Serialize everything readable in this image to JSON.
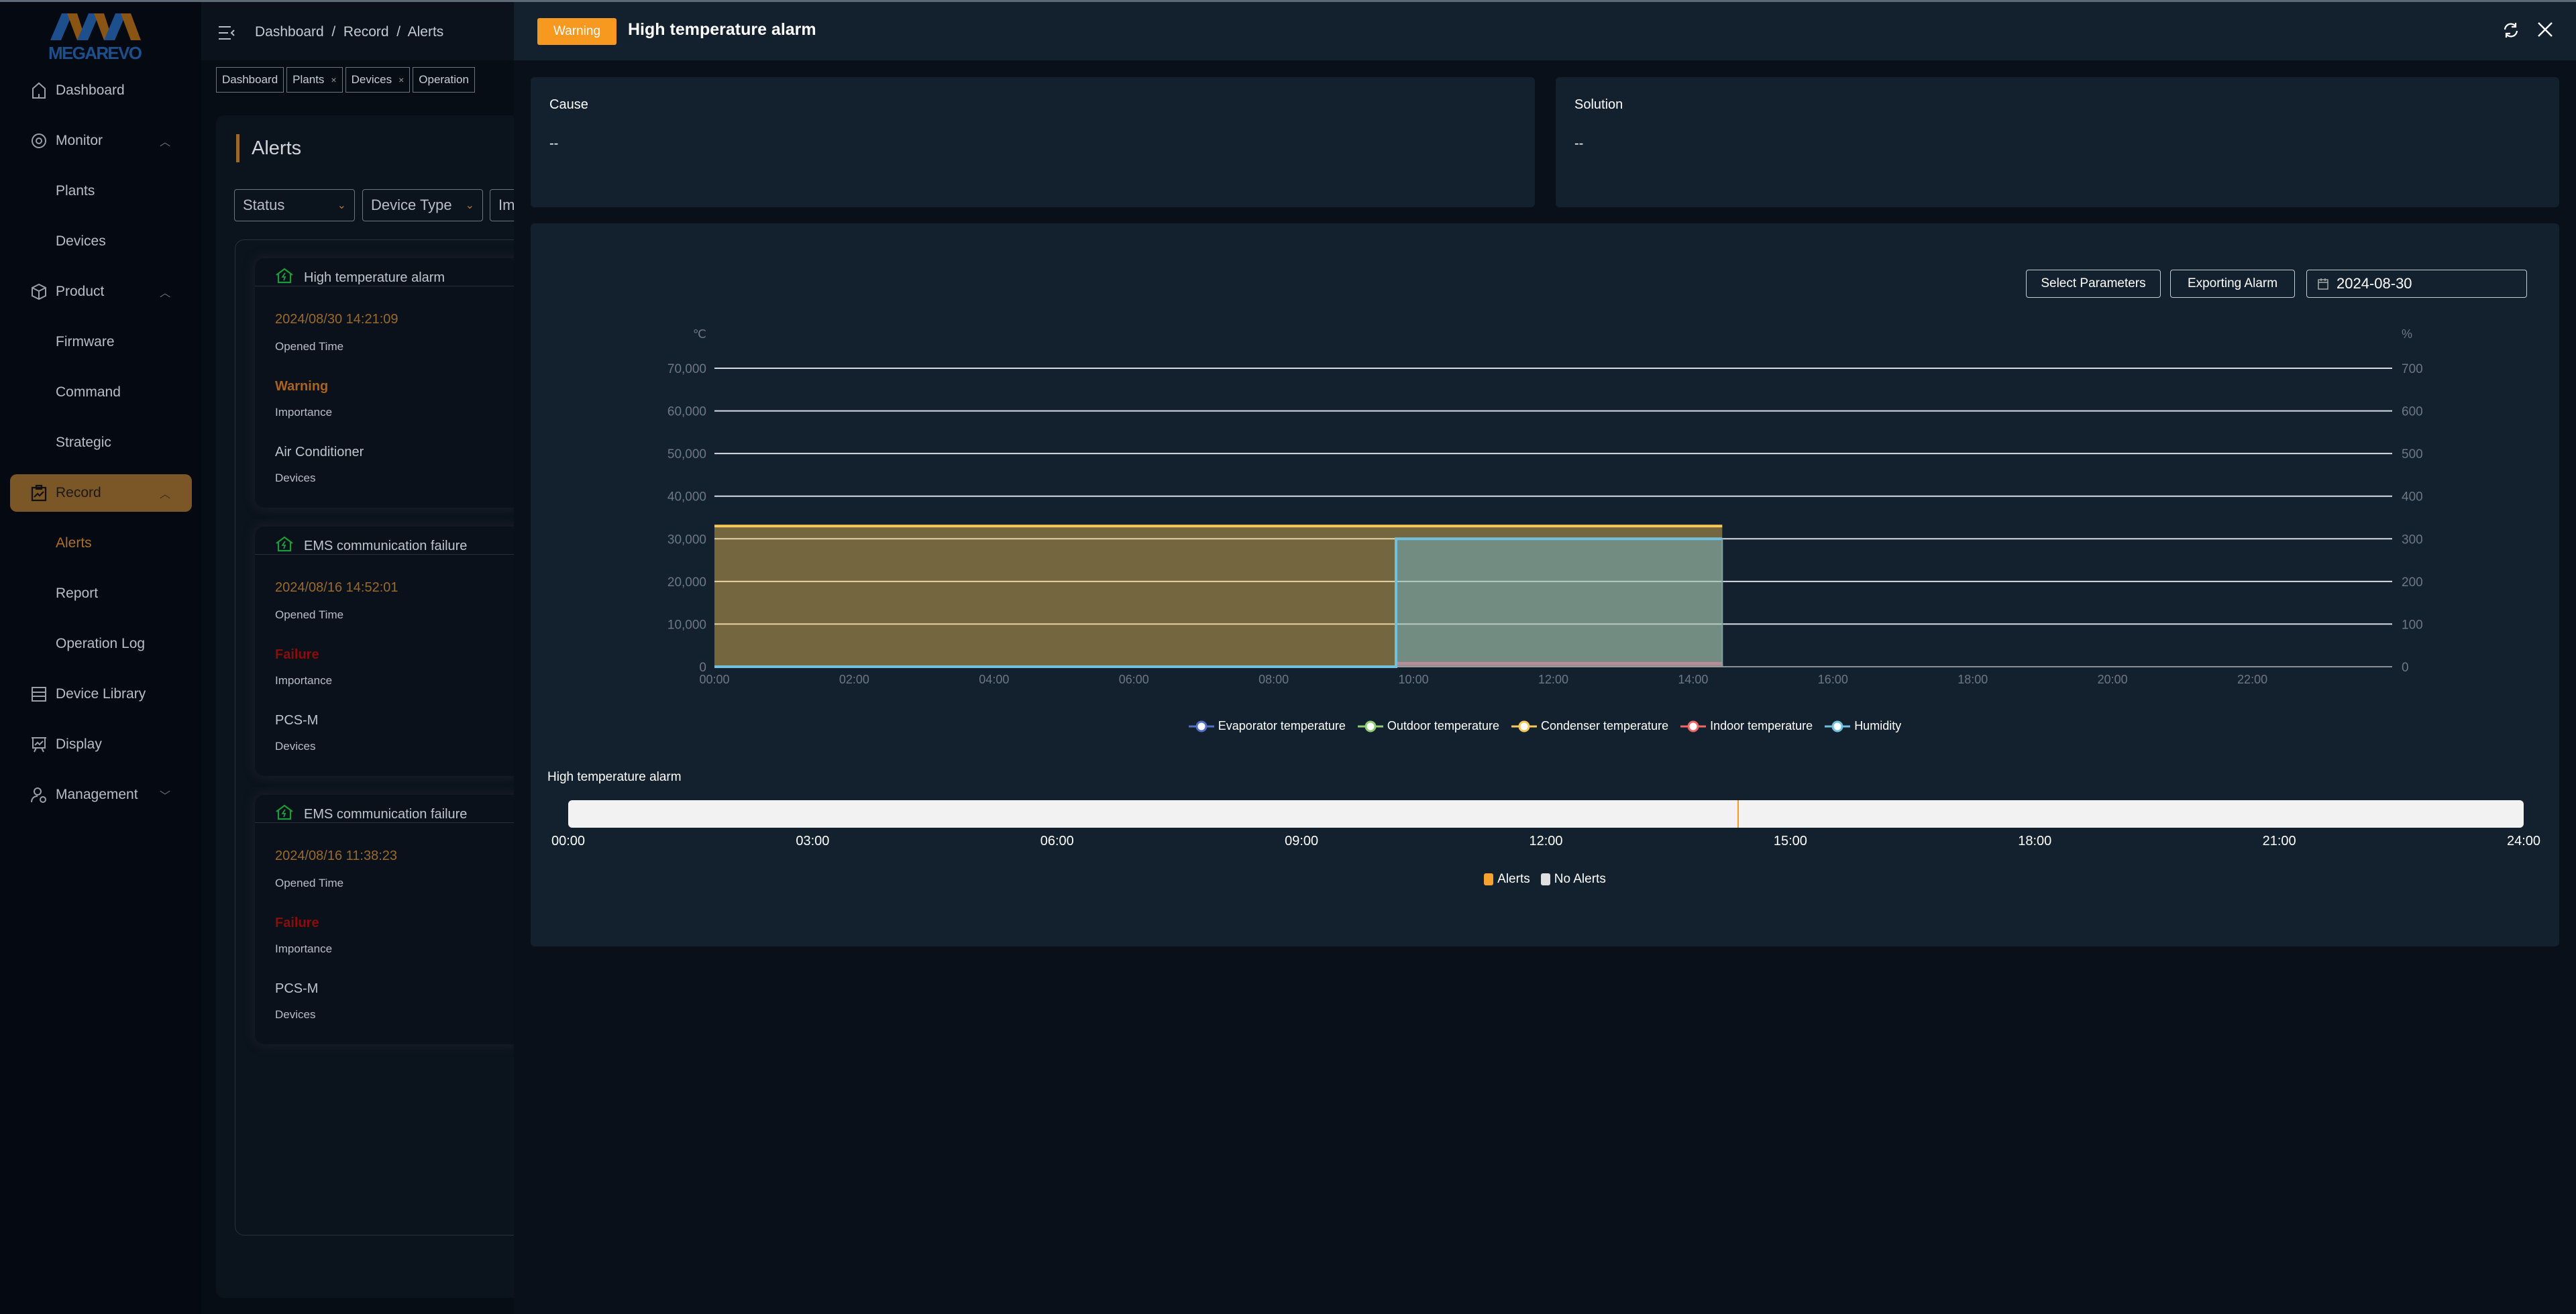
{
  "brand": {
    "name": "MEGAREVO"
  },
  "sidebar": {
    "items": [
      {
        "label": "Dashboard",
        "icon": "home-icon"
      },
      {
        "label": "Monitor",
        "icon": "eye-icon",
        "expanded": true
      },
      {
        "label": "Plants",
        "sub": true
      },
      {
        "label": "Devices",
        "sub": true
      },
      {
        "label": "Product",
        "icon": "cube-icon",
        "expanded": true
      },
      {
        "label": "Firmware",
        "sub": true
      },
      {
        "label": "Command",
        "sub": true
      },
      {
        "label": "Strategic",
        "sub": true
      },
      {
        "label": "Record",
        "icon": "clipboard-chart-icon",
        "expanded": true,
        "active": true
      },
      {
        "label": "Alerts",
        "sub": true,
        "selected": true
      },
      {
        "label": "Report",
        "sub": true
      },
      {
        "label": "Operation Log",
        "sub": true
      },
      {
        "label": "Device Library",
        "icon": "server-icon"
      },
      {
        "label": "Display",
        "icon": "presentation-icon"
      },
      {
        "label": "Management",
        "icon": "user-settings-icon",
        "expanded": false
      }
    ]
  },
  "header": {
    "breadcrumb": "Dashboard  /  Record  /  Alerts"
  },
  "tags": [
    {
      "label": "Dashboard",
      "closable": false
    },
    {
      "label": "Plants",
      "closable": true
    },
    {
      "label": "Devices",
      "closable": true
    },
    {
      "label": "Operation",
      "closable": false
    }
  ],
  "alerts_page": {
    "title": "Alerts",
    "filters": [
      "Status",
      "Device Type",
      "Im"
    ],
    "cards": [
      {
        "title": "High temperature alarm",
        "time": "2024/08/30 14:21:09",
        "time_label": "Opened Time",
        "importance": "Warning",
        "importance_color": "#a9631f",
        "importance_label": "Importance",
        "device": "Air Conditioner",
        "device_label": "Devices"
      },
      {
        "title": "EMS communication failure",
        "time": "2024/08/16 14:52:01",
        "time_label": "Opened Time",
        "importance": "Failure",
        "importance_color": "#8b0c0c",
        "importance_label": "Importance",
        "device": "PCS-M",
        "device_label": "Devices"
      },
      {
        "title": "EMS communication failure",
        "time": "2024/08/16 11:38:23",
        "time_label": "Opened Time",
        "importance": "Failure",
        "importance_color": "#8b0c0c",
        "importance_label": "Importance",
        "device": "PCS-M",
        "device_label": "Devices"
      }
    ]
  },
  "drawer": {
    "badge": "Warning",
    "badge_color": "#f7981f",
    "title": "High temperature alarm",
    "cause": {
      "label": "Cause",
      "value": "--"
    },
    "solution": {
      "label": "Solution",
      "value": "--"
    },
    "buttons": {
      "select_parameters": "Select Parameters",
      "exporting_alarm": "Exporting Alarm"
    },
    "date": "2024-08-30",
    "timeline": {
      "label": "High temperature alarm",
      "ticks": [
        "00:00",
        "03:00",
        "06:00",
        "09:00",
        "12:00",
        "15:00",
        "18:00",
        "21:00",
        "24:00"
      ],
      "alert_times": [
        "14:21"
      ],
      "legend": [
        {
          "label": "Alerts",
          "color": "#f7a230"
        },
        {
          "label": "No Alerts",
          "color": "#e0e0e0"
        }
      ]
    }
  },
  "chart_data": {
    "type": "area",
    "y_left": {
      "unit": "℃",
      "ylim": [
        0,
        70000
      ],
      "ticks": [
        "0",
        "10,000",
        "20,000",
        "30,000",
        "40,000",
        "50,000",
        "60,000",
        "70,000"
      ]
    },
    "y_right": {
      "unit": "%",
      "ylim": [
        0,
        700
      ],
      "ticks": [
        "0",
        "100",
        "200",
        "300",
        "400",
        "500",
        "600",
        "700"
      ]
    },
    "x": {
      "ticks": [
        "00:00",
        "02:00",
        "04:00",
        "06:00",
        "08:00",
        "10:00",
        "12:00",
        "14:00",
        "16:00",
        "18:00",
        "20:00",
        "22:00"
      ],
      "range": [
        "00:00",
        "24:00"
      ]
    },
    "grid": true,
    "legend_position": "bottom",
    "series": [
      {
        "name": "Evaporator temperature",
        "color": "#5470c6",
        "axis": "left",
        "points": []
      },
      {
        "name": "Outdoor temperature",
        "color": "#91cc75",
        "axis": "left",
        "points": []
      },
      {
        "name": "Condenser temperature",
        "color": "#fac858",
        "axis": "left",
        "points": [
          [
            "00:00",
            33000
          ],
          [
            "14:25",
            33000
          ]
        ]
      },
      {
        "name": "Indoor temperature",
        "color": "#ee6666",
        "axis": "left",
        "points": [
          [
            "09:45",
            800
          ],
          [
            "14:25",
            800
          ]
        ]
      },
      {
        "name": "Humidity",
        "color": "#73c0de",
        "axis": "right",
        "points": [
          [
            "00:00",
            0
          ],
          [
            "09:45",
            0
          ],
          [
            "09:45",
            300
          ],
          [
            "14:25",
            300
          ]
        ]
      }
    ]
  }
}
